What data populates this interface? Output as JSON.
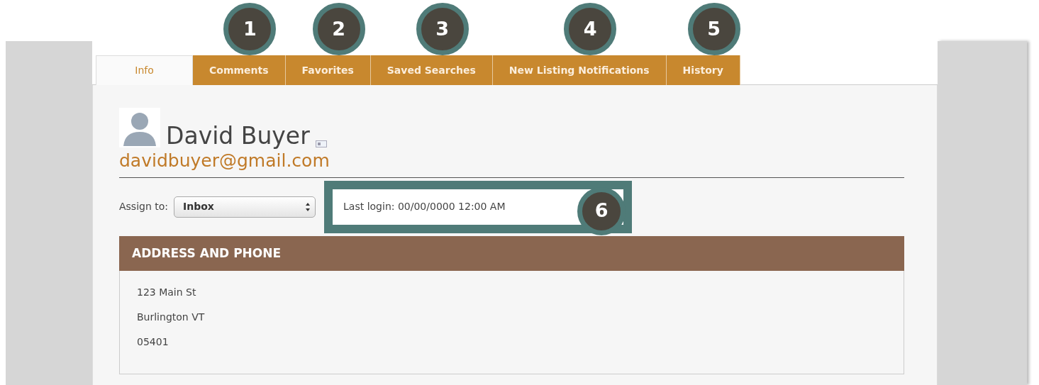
{
  "tabs": [
    {
      "label": "Info",
      "selected": true
    },
    {
      "label": "Comments",
      "selected": false,
      "callout": "1"
    },
    {
      "label": "Favorites",
      "selected": false,
      "callout": "2"
    },
    {
      "label": "Saved Searches",
      "selected": false,
      "callout": "3"
    },
    {
      "label": "New Listing Notifications",
      "selected": false,
      "callout": "4"
    },
    {
      "label": "History",
      "selected": false,
      "callout": "5"
    }
  ],
  "contact": {
    "name": "David Buyer",
    "email": "davidbuyer@gmail.com"
  },
  "assign": {
    "label": "Assign to:",
    "value": "Inbox"
  },
  "last_login": {
    "text": "Last login: 00/00/0000 12:00 AM",
    "callout": "6"
  },
  "section": {
    "title": "ADDRESS AND PHONE",
    "lines": [
      "123 Main St",
      "Burlington VT",
      "05401"
    ]
  }
}
